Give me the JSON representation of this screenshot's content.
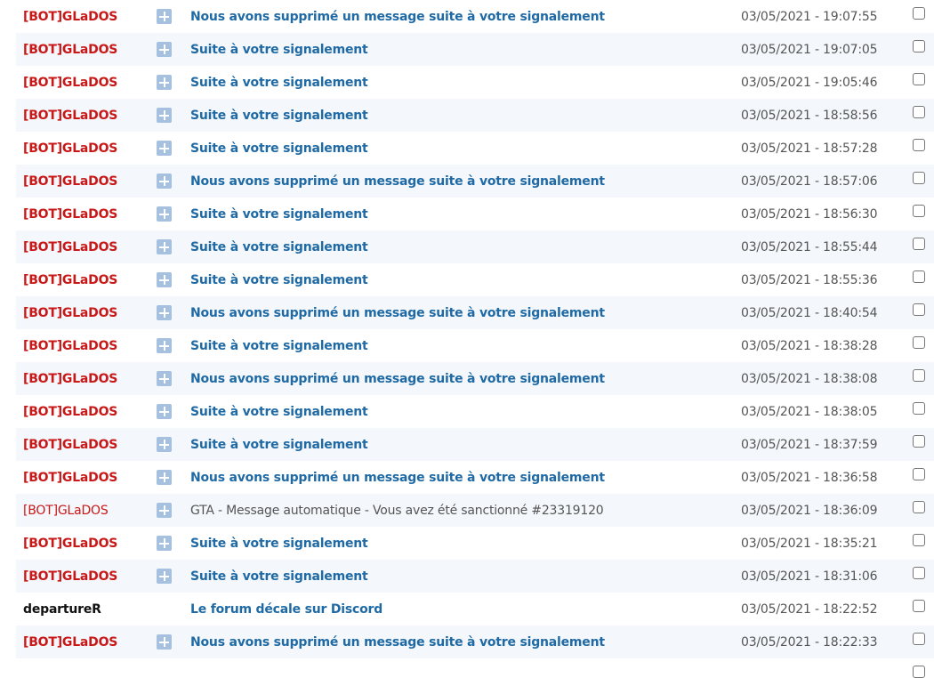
{
  "messages": [
    {
      "author": "[BOT]GLaDOS",
      "author_role": "bot",
      "unread": true,
      "expandable": true,
      "subject": "Nous avons supprimé un message suite à votre signalement",
      "date": "03/05/2021 - 19:07:55"
    },
    {
      "author": "[BOT]GLaDOS",
      "author_role": "bot",
      "unread": true,
      "expandable": true,
      "subject": "Suite à votre signalement",
      "date": "03/05/2021 - 19:07:05"
    },
    {
      "author": "[BOT]GLaDOS",
      "author_role": "bot",
      "unread": true,
      "expandable": true,
      "subject": "Suite à votre signalement",
      "date": "03/05/2021 - 19:05:46"
    },
    {
      "author": "[BOT]GLaDOS",
      "author_role": "bot",
      "unread": true,
      "expandable": true,
      "subject": "Suite à votre signalement",
      "date": "03/05/2021 - 18:58:56"
    },
    {
      "author": "[BOT]GLaDOS",
      "author_role": "bot",
      "unread": true,
      "expandable": true,
      "subject": "Suite à votre signalement",
      "date": "03/05/2021 - 18:57:28"
    },
    {
      "author": "[BOT]GLaDOS",
      "author_role": "bot",
      "unread": true,
      "expandable": true,
      "subject": "Nous avons supprimé un message suite à votre signalement",
      "date": "03/05/2021 - 18:57:06"
    },
    {
      "author": "[BOT]GLaDOS",
      "author_role": "bot",
      "unread": true,
      "expandable": true,
      "subject": "Suite à votre signalement",
      "date": "03/05/2021 - 18:56:30"
    },
    {
      "author": "[BOT]GLaDOS",
      "author_role": "bot",
      "unread": true,
      "expandable": true,
      "subject": "Suite à votre signalement",
      "date": "03/05/2021 - 18:55:44"
    },
    {
      "author": "[BOT]GLaDOS",
      "author_role": "bot",
      "unread": true,
      "expandable": true,
      "subject": "Suite à votre signalement",
      "date": "03/05/2021 - 18:55:36"
    },
    {
      "author": "[BOT]GLaDOS",
      "author_role": "bot",
      "unread": true,
      "expandable": true,
      "subject": "Nous avons supprimé un message suite à votre signalement",
      "date": "03/05/2021 - 18:40:54"
    },
    {
      "author": "[BOT]GLaDOS",
      "author_role": "bot",
      "unread": true,
      "expandable": true,
      "subject": "Suite à votre signalement",
      "date": "03/05/2021 - 18:38:28"
    },
    {
      "author": "[BOT]GLaDOS",
      "author_role": "bot",
      "unread": true,
      "expandable": true,
      "subject": "Nous avons supprimé un message suite à votre signalement",
      "date": "03/05/2021 - 18:38:08"
    },
    {
      "author": "[BOT]GLaDOS",
      "author_role": "bot",
      "unread": true,
      "expandable": true,
      "subject": "Suite à votre signalement",
      "date": "03/05/2021 - 18:38:05"
    },
    {
      "author": "[BOT]GLaDOS",
      "author_role": "bot",
      "unread": true,
      "expandable": true,
      "subject": "Suite à votre signalement",
      "date": "03/05/2021 - 18:37:59"
    },
    {
      "author": "[BOT]GLaDOS",
      "author_role": "bot",
      "unread": true,
      "expandable": true,
      "subject": "Nous avons supprimé un message suite à votre signalement",
      "date": "03/05/2021 - 18:36:58"
    },
    {
      "author": "[BOT]GLaDOS",
      "author_role": "bot",
      "unread": false,
      "expandable": true,
      "subject": "GTA - Message automatique - Vous avez été sanctionné #23319120",
      "date": "03/05/2021 - 18:36:09"
    },
    {
      "author": "[BOT]GLaDOS",
      "author_role": "bot",
      "unread": true,
      "expandable": true,
      "subject": "Suite à votre signalement",
      "date": "03/05/2021 - 18:35:21"
    },
    {
      "author": "[BOT]GLaDOS",
      "author_role": "bot",
      "unread": true,
      "expandable": true,
      "subject": "Suite à votre signalement",
      "date": "03/05/2021 - 18:31:06"
    },
    {
      "author": "departureR",
      "author_role": "member",
      "unread": true,
      "expandable": false,
      "subject": "Le forum décale sur Discord",
      "date": "03/05/2021 - 18:22:52"
    },
    {
      "author": "[BOT]GLaDOS",
      "author_role": "bot",
      "unread": true,
      "expandable": true,
      "subject": "Nous avons supprimé un message suite à votre signalement",
      "date": "03/05/2021 - 18:22:33"
    }
  ],
  "colors": {
    "bot_author": "#c81818",
    "member_author": "#111111",
    "subject_link": "#1f6aa5",
    "read_subject": "#555555",
    "row_alt_bg": "#f4f7fb",
    "expand_icon": "#a6c1df"
  },
  "icons": {
    "expand": "plus-square-icon"
  }
}
